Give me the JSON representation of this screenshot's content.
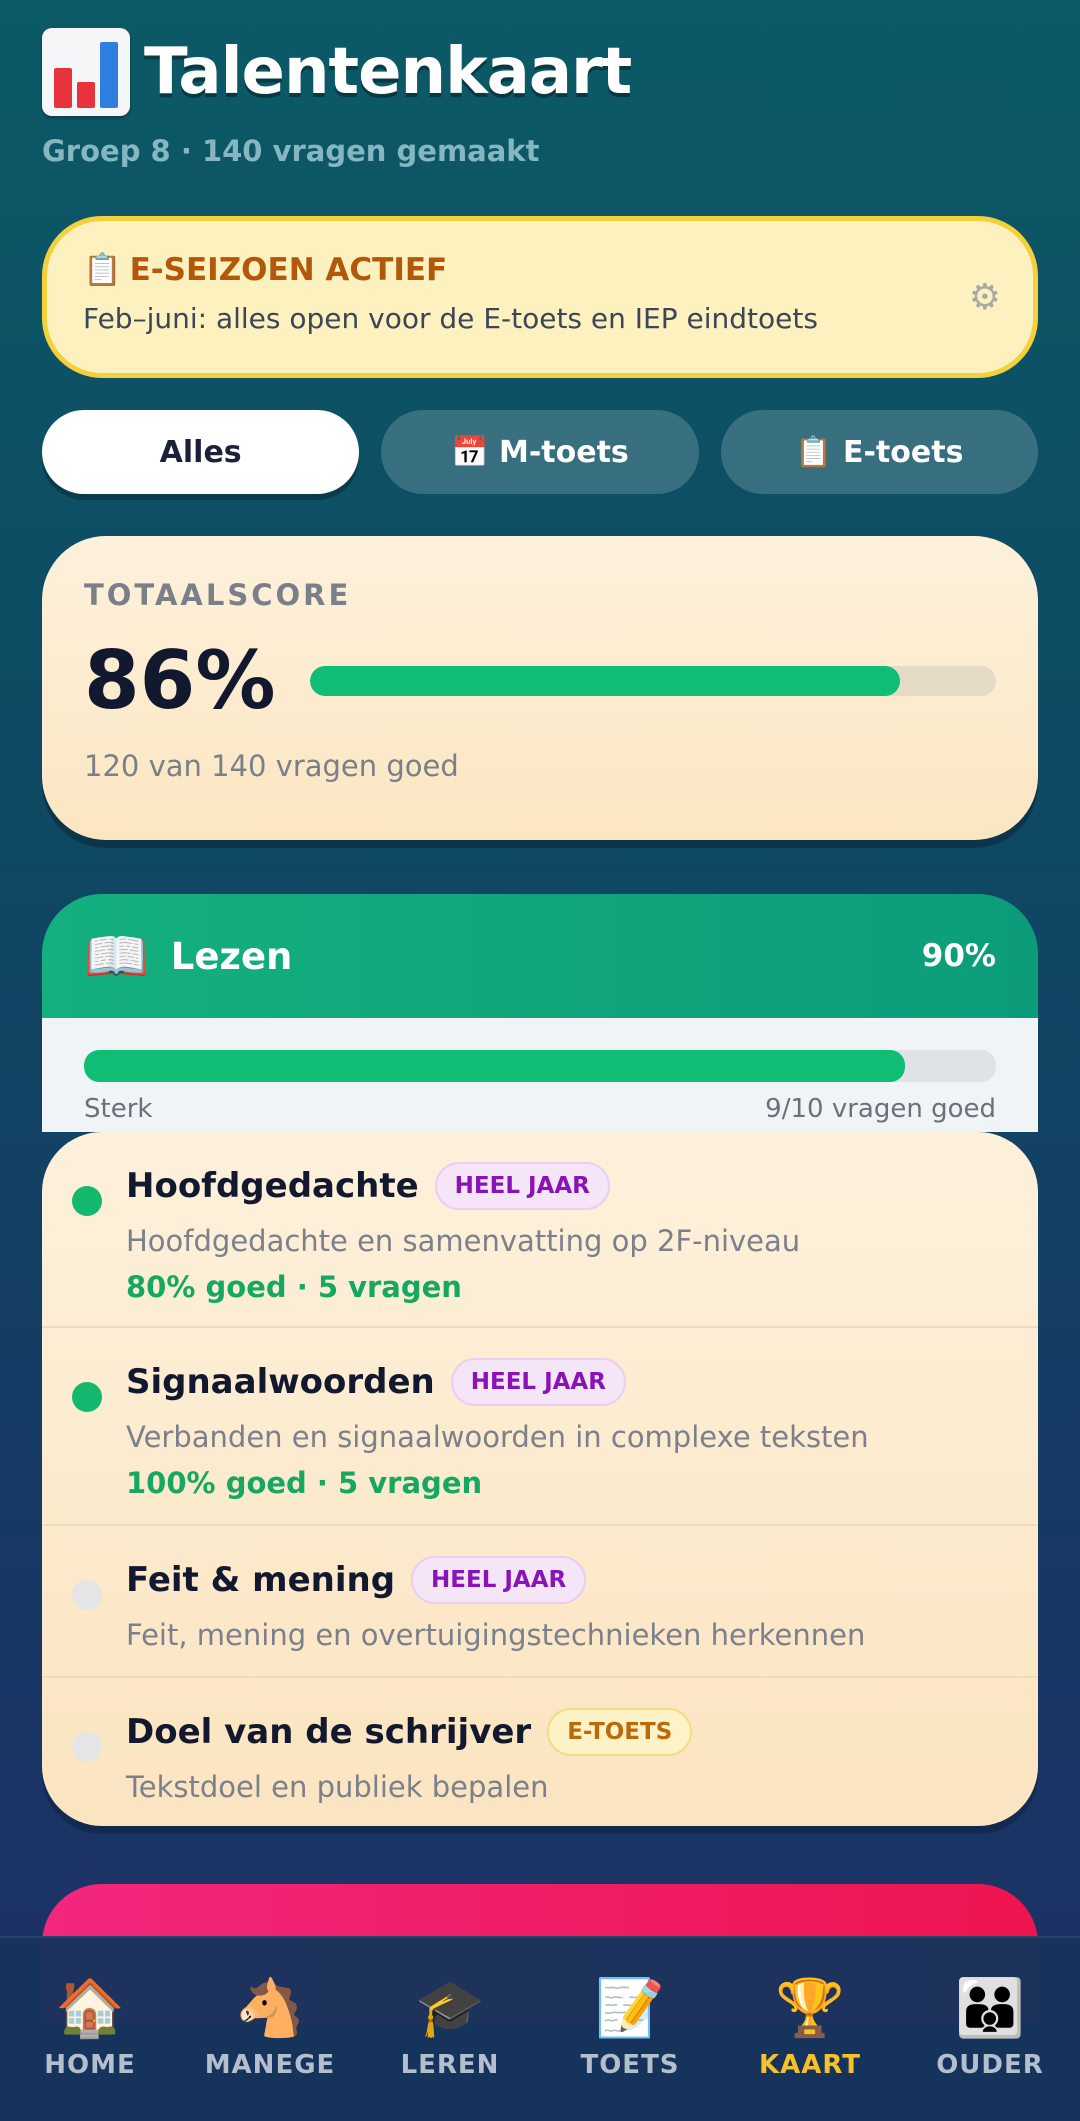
{
  "header": {
    "title": "Talentenkaart",
    "subtitle": "Groep 8 · 140 vragen gemaakt"
  },
  "banner": {
    "icon": "📋",
    "title": "E-SEIZOEN ACTIEF",
    "text": "Feb–juni: alles open voor de E-toets en IEP eindtoets",
    "gear": "⚙"
  },
  "tabs": [
    {
      "label": "Alles",
      "active": true
    },
    {
      "label": "📅 M-toets",
      "active": false
    },
    {
      "label": "📋 E-toets",
      "active": false
    }
  ],
  "total": {
    "label": "TOTAALSCORE",
    "percent_text": "86%",
    "percent": 0.86,
    "detail": "120 van 140 vragen goed"
  },
  "section": {
    "icon": "📖",
    "title": "Lezen",
    "percent_text": "90%",
    "percent": 0.9,
    "level": "Sterk",
    "detail": "9/10 vragen goed"
  },
  "topics": [
    {
      "title": "Hoofdgedachte",
      "badge": "HEEL JAAR",
      "badge_style": "purple",
      "desc": "Hoofdgedachte en samenvatting op 2F-niveau",
      "score": "80% goed · 5 vragen",
      "done": true
    },
    {
      "title": "Signaalwoorden",
      "badge": "HEEL JAAR",
      "badge_style": "purple",
      "desc": "Verbanden en signaalwoorden in complexe teksten",
      "score": "100% goed · 5 vragen",
      "done": true
    },
    {
      "title": "Feit & mening",
      "badge": "HEEL JAAR",
      "badge_style": "purple",
      "desc": "Feit, mening en overtuigingstechnieken herkennen",
      "score": "",
      "done": false
    },
    {
      "title": "Doel van de schrijver",
      "badge": "E-TOETS",
      "badge_style": "yellow",
      "desc": "Tekstdoel en publiek bepalen",
      "score": "",
      "done": false
    }
  ],
  "nav": [
    {
      "icon": "🏠",
      "label": "HOME",
      "active": false
    },
    {
      "icon": "🐴",
      "label": "MANEGE",
      "active": false
    },
    {
      "icon": "🎓",
      "label": "LEREN",
      "active": false
    },
    {
      "icon": "📝",
      "label": "TOETS",
      "active": false
    },
    {
      "icon": "🏆",
      "label": "KAART",
      "active": true
    },
    {
      "icon": "👪",
      "label": "OUDER",
      "active": false
    }
  ],
  "colors": {
    "accent_green": "#0fbd74",
    "banner_yellow": "#fdf2bf",
    "nav_active": "#f6c129"
  }
}
